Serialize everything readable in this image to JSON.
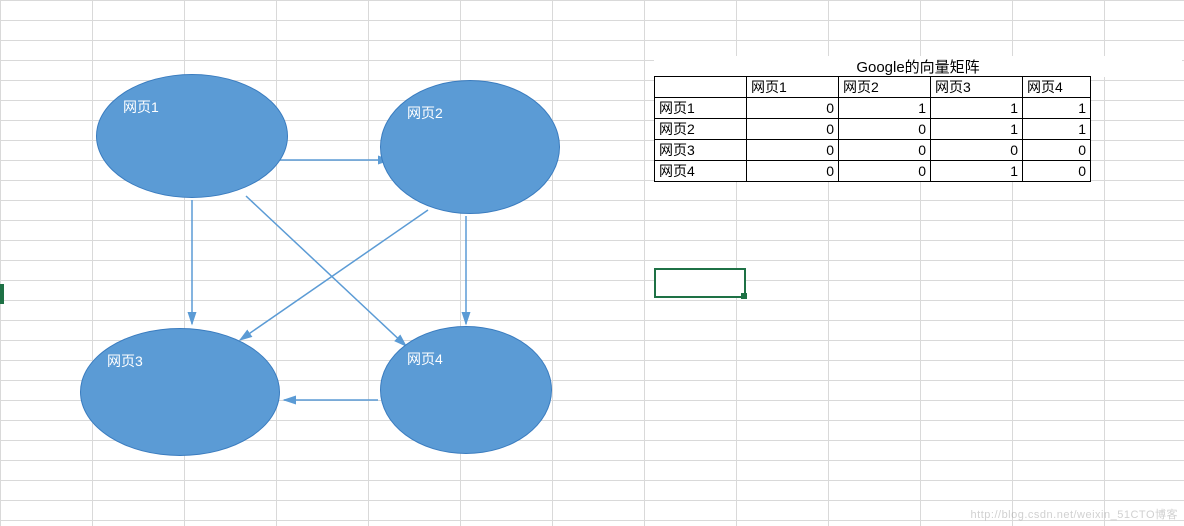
{
  "diagram": {
    "nodes": {
      "n1": "网页1",
      "n2": "网页2",
      "n3": "网页3",
      "n4": "网页4"
    }
  },
  "table": {
    "title": "Google的向量矩阵",
    "cols": [
      "网页1",
      "网页2",
      "网页3",
      "网页4"
    ],
    "rows": [
      "网页1",
      "网页2",
      "网页3",
      "网页4"
    ],
    "data": [
      [
        0,
        1,
        1,
        1
      ],
      [
        0,
        0,
        1,
        1
      ],
      [
        0,
        0,
        0,
        0
      ],
      [
        0,
        0,
        1,
        0
      ]
    ]
  },
  "chart_data": {
    "type": "table",
    "title": "Google的向量矩阵",
    "columns": [
      "",
      "网页1",
      "网页2",
      "网页3",
      "网页4"
    ],
    "rows": [
      [
        "网页1",
        0,
        1,
        1,
        1
      ],
      [
        "网页2",
        0,
        0,
        1,
        1
      ],
      [
        "网页3",
        0,
        0,
        0,
        0
      ],
      [
        "网页4",
        0,
        0,
        1,
        0
      ]
    ],
    "graph_edges": [
      [
        "网页1",
        "网页2"
      ],
      [
        "网页1",
        "网页3"
      ],
      [
        "网页1",
        "网页4"
      ],
      [
        "网页2",
        "网页3"
      ],
      [
        "网页2",
        "网页4"
      ],
      [
        "网页4",
        "网页3"
      ]
    ]
  },
  "watermark": "http://blog.csdn.net/weixin_51CTO博客"
}
